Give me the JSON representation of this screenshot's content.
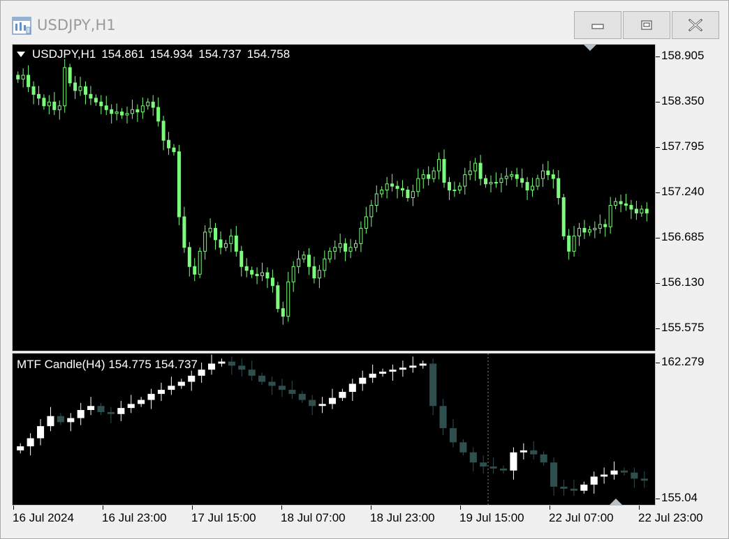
{
  "window": {
    "title": "USDJPY,H1",
    "icon": "chart-window-icon",
    "buttons": {
      "minimize": "minimize-icon",
      "maximize": "maximize-icon",
      "close": "close-icon"
    }
  },
  "main_chart": {
    "symbol": "USDJPY,H1",
    "open": "154.861",
    "high": "154.934",
    "low": "154.737",
    "close": "154.758",
    "price_labels": [
      "158.905",
      "158.350",
      "157.795",
      "157.240",
      "156.685",
      "156.130",
      "155.575"
    ],
    "colors": {
      "background": "#000000",
      "candle": "#7CFC7C"
    }
  },
  "indicator": {
    "name": "MTF Candle(H4)",
    "value1": "154.775",
    "value2": "154.737",
    "price_labels": [
      "162.279",
      "155.04"
    ],
    "colors": {
      "bull": "#ffffff",
      "bear": "#2f4f4f"
    }
  },
  "time_axis": {
    "labels": [
      "16 Jul 2024",
      "16 Jul 23:00",
      "17 Jul 15:00",
      "18 Jul 07:00",
      "18 Jul 23:00",
      "19 Jul 15:00",
      "22 Jul 07:00",
      "22 Jul 23:00"
    ]
  },
  "chart_data": [
    {
      "type": "candlestick",
      "title": "USDJPY,H1",
      "ylim": [
        155.2,
        159.2
      ],
      "series": [
        {
          "name": "USDJPY,H1",
          "ohlc_close_path": [
            158.75,
            158.8,
            158.65,
            158.55,
            158.5,
            158.4,
            158.45,
            158.35,
            158.4,
            158.9,
            158.7,
            158.6,
            158.65,
            158.55,
            158.5,
            158.45,
            158.4,
            158.35,
            158.3,
            158.32,
            158.28,
            158.3,
            158.35,
            158.32,
            158.4,
            158.45,
            158.38,
            158.2,
            157.95,
            157.85,
            157.8,
            156.95,
            156.55,
            156.3,
            156.2,
            156.5,
            156.75,
            156.8,
            156.65,
            156.55,
            156.6,
            156.7,
            156.5,
            156.3,
            156.25,
            156.2,
            156.18,
            156.22,
            156.15,
            156.05,
            155.75,
            155.65,
            156.1,
            156.3,
            156.4,
            156.45,
            156.3,
            156.15,
            156.25,
            156.4,
            156.5,
            156.55,
            156.6,
            156.5,
            156.55,
            156.6,
            156.8,
            156.95,
            157.1,
            157.25,
            157.3,
            157.38,
            157.35,
            157.32,
            157.3,
            157.2,
            157.28,
            157.45,
            157.5,
            157.45,
            157.55,
            157.7,
            157.4,
            157.3,
            157.3,
            157.35,
            157.5,
            157.55,
            157.65,
            157.45,
            157.38,
            157.4,
            157.4,
            157.45,
            157.48,
            157.5,
            157.45,
            157.4,
            157.3,
            157.35,
            157.45,
            157.55,
            157.5,
            157.45,
            157.2,
            156.7,
            156.5,
            156.7,
            156.8,
            156.75,
            156.78,
            156.8,
            156.85,
            156.82,
            157.1,
            157.15,
            157.12,
            157.1,
            157.05,
            157.0,
            157.05,
            157.0
          ]
        }
      ]
    },
    {
      "type": "candlestick",
      "title": "MTF Candle(H4)",
      "ylim": [
        154.9,
        162.4
      ],
      "series": [
        {
          "name": "MTF Candle(H4)",
          "close_path": [
            157.8,
            158.2,
            158.8,
            159.3,
            159.0,
            159.2,
            159.6,
            159.8,
            159.5,
            159.4,
            159.7,
            159.9,
            160.1,
            160.4,
            160.6,
            160.8,
            161.0,
            161.3,
            161.6,
            161.9,
            162.0,
            161.8,
            161.6,
            161.3,
            161.0,
            160.8,
            160.6,
            160.4,
            160.1,
            159.8,
            159.9,
            160.2,
            160.5,
            160.9,
            161.2,
            161.4,
            161.5,
            161.6,
            161.7,
            161.8,
            161.9,
            159.8,
            158.7,
            158.0,
            157.5,
            157.0,
            156.8,
            156.7,
            156.6,
            157.5,
            157.6,
            157.4,
            157.0,
            155.8,
            155.7,
            155.6,
            155.9,
            156.3,
            156.4,
            156.6,
            156.5,
            156.2,
            156.1
          ]
        }
      ]
    }
  ]
}
